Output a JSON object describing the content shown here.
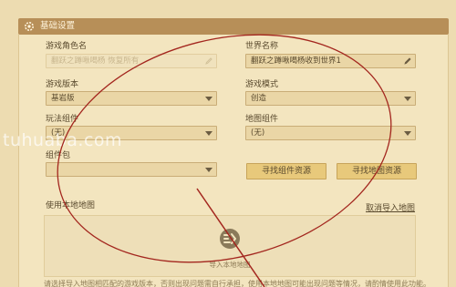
{
  "header": {
    "title": "基础设置"
  },
  "form": {
    "role_name": {
      "label": "游戏角色名",
      "value": "翻跃之蹲啾喝杨 恢复所有"
    },
    "world_name": {
      "label": "世界名称",
      "value": "翻跃之蹲啾喝杨收到世界1"
    },
    "game_version": {
      "label": "游戏版本",
      "value": "基岩版"
    },
    "game_mode": {
      "label": "游戏模式",
      "value": "创造"
    },
    "gameplay_component": {
      "label": "玩法组件",
      "value": "(无)"
    },
    "map_component": {
      "label": "地图组件",
      "value": "(无)"
    },
    "component_pack": {
      "label": "组件包",
      "value": ""
    }
  },
  "buttons": {
    "find_component": "寻找组件资源",
    "find_map": "寻找地图资源"
  },
  "local_map": {
    "label": "使用本地地图",
    "cancel_link": "取消导入地图",
    "import_label": "导入本地地图"
  },
  "note": "请选择导入地图相匹配的游戏版本，否则出现问题需自行承担，使用本地地图可能出现问题等情况，请酌情使用此功能。",
  "watermark": "tuhuaba.com",
  "colors": {
    "header": "#b78f58",
    "panel": "#f3e5bf",
    "button": "#e8c97b",
    "annotation": "#a3261e"
  }
}
